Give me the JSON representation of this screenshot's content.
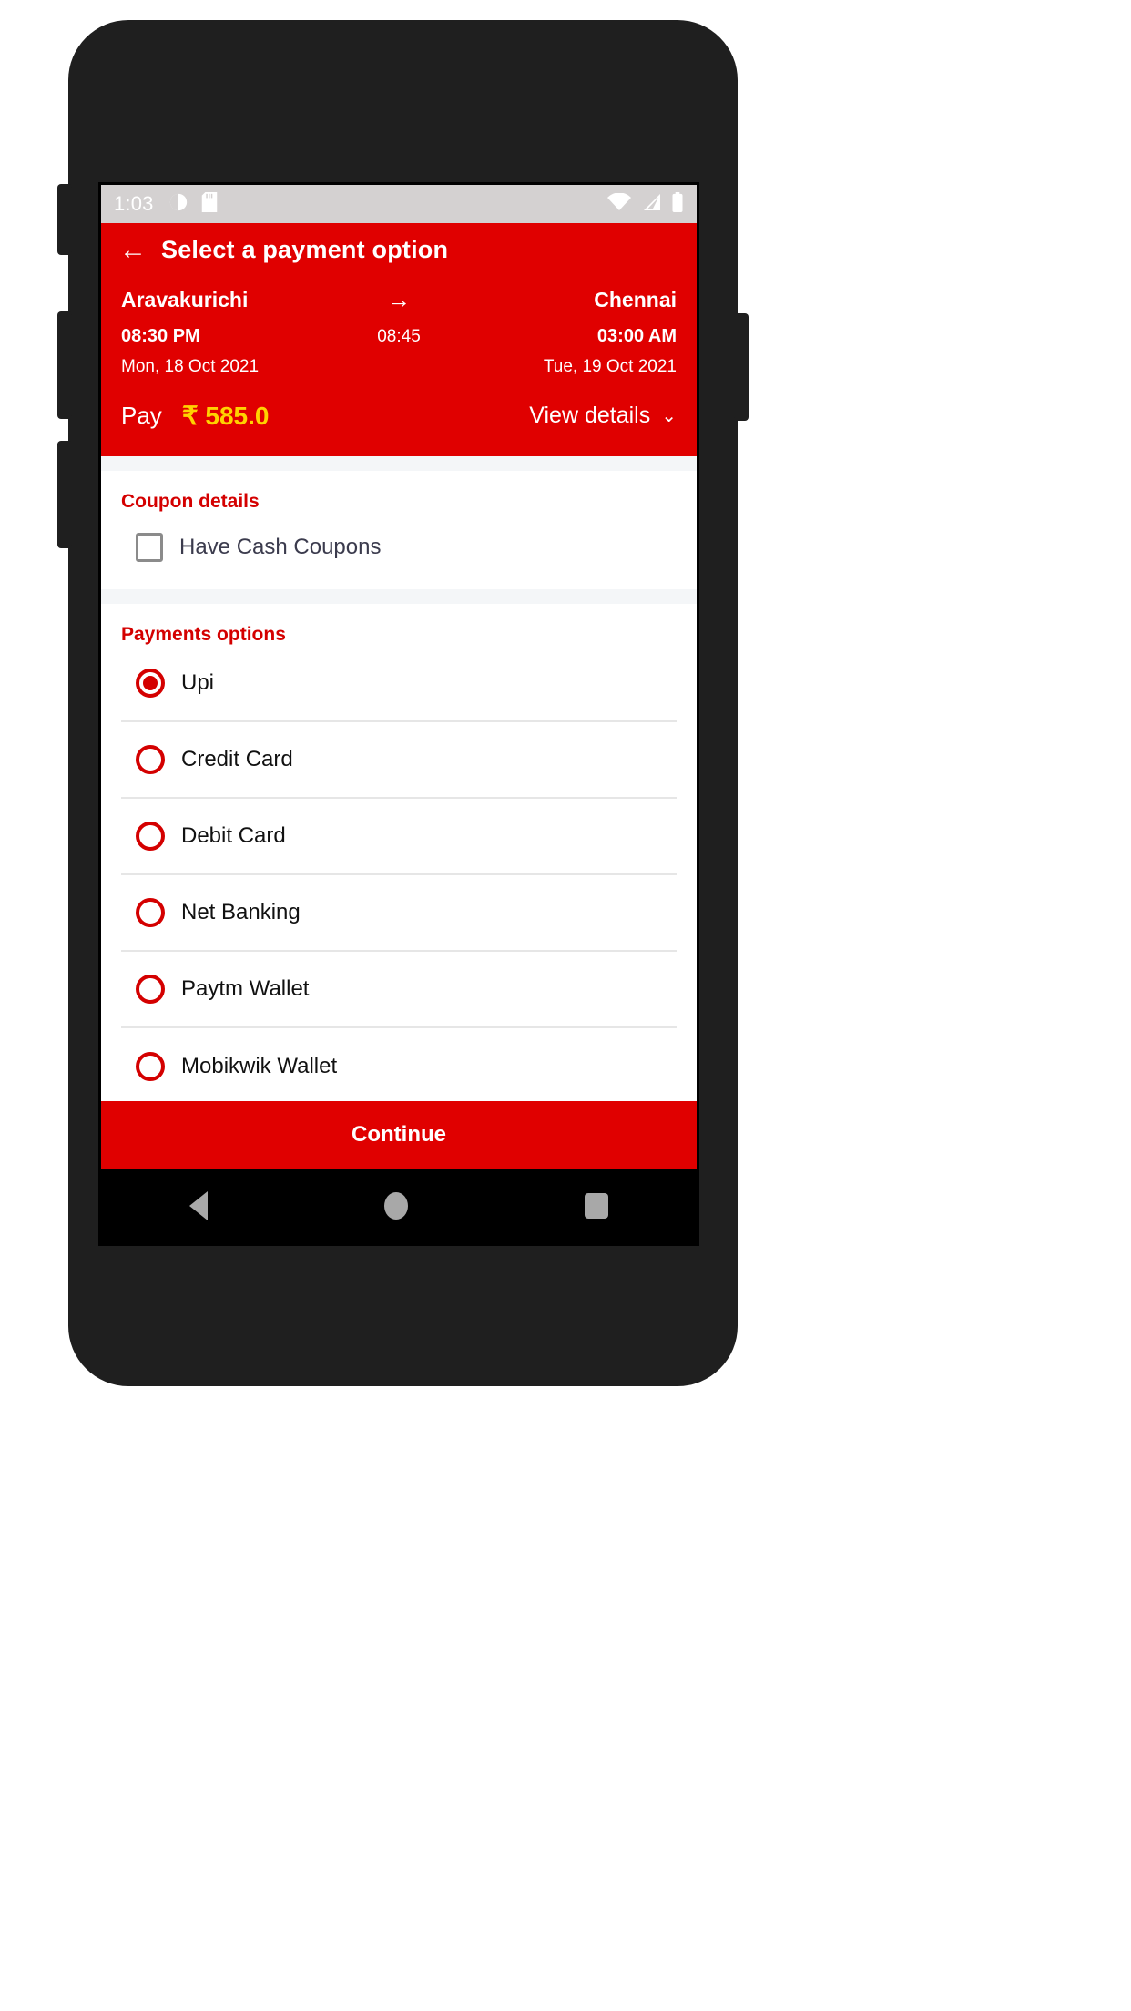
{
  "status_bar": {
    "time": "1:03",
    "left_icons": [
      "alarm-icon",
      "sd-card-icon"
    ],
    "right_icons": [
      "wifi-icon",
      "cellular-signal-icon",
      "battery-icon"
    ]
  },
  "app_bar": {
    "back_icon": "←",
    "title": "Select a payment option"
  },
  "journey": {
    "origin": "Aravakurichi",
    "destination": "Chennai",
    "arrow": "→",
    "departure_time": "08:30 PM",
    "duration": "08:45",
    "arrival_time": "03:00 AM",
    "departure_date": "Mon, 18 Oct 2021",
    "arrival_date": "Tue, 19 Oct 2021"
  },
  "pay": {
    "label": "Pay",
    "amount": "₹ 585.0",
    "view_details_label": "View details",
    "chevron": "⌄"
  },
  "coupon": {
    "title": "Coupon details",
    "checkbox_label": "Have Cash Coupons",
    "checked": false
  },
  "payments": {
    "title": "Payments options",
    "options": [
      {
        "label": "Upi",
        "selected": true
      },
      {
        "label": "Credit Card",
        "selected": false
      },
      {
        "label": "Debit Card",
        "selected": false
      },
      {
        "label": "Net Banking",
        "selected": false
      },
      {
        "label": "Paytm Wallet",
        "selected": false
      },
      {
        "label": "Mobikwik Wallet",
        "selected": false
      }
    ]
  },
  "footer": {
    "continue_label": "Continue"
  },
  "nav_bar": {
    "back": "back-triangle-icon",
    "home": "home-circle-icon",
    "recents": "recents-square-icon"
  },
  "colors": {
    "brand_red": "#e00000",
    "title_red": "#d40000",
    "amount_yellow": "#ffd200",
    "status_bar_bg": "#d4d1d1",
    "page_bg": "#f4f6f8"
  }
}
